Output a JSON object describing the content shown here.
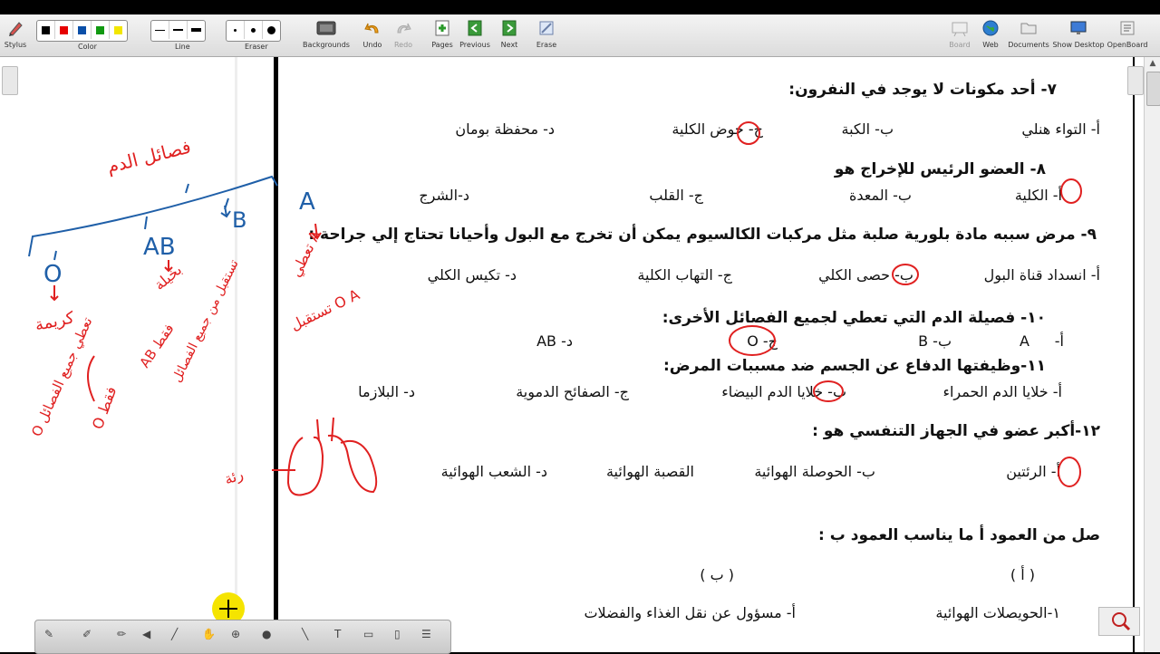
{
  "toolbar": {
    "stylus_label": "Stylus",
    "color_label": "Color",
    "line_label": "Line",
    "eraser_label": "Eraser",
    "backgrounds_label": "Backgrounds",
    "undo_label": "Undo",
    "redo_label": "Redo",
    "pages_label": "Pages",
    "previous_label": "Previous",
    "next_label": "Next",
    "erase_label": "Erase",
    "board_label": "Board",
    "web_label": "Web",
    "documents_label": "Documents",
    "show_desktop_label": "Show Desktop",
    "openboard_label": "OpenBoard",
    "colors": [
      "#000000",
      "#e60000",
      "#0a4fa8",
      "#119911",
      "#f2e600"
    ]
  },
  "questions": {
    "q7": {
      "text": "٧- أحد مكونات لا يوجد في النفرون:",
      "a": "أ- التواء هنلي",
      "b": "ب- الكبة",
      "c": "ج- حوض الكلية",
      "d": "د- محفظة بومان"
    },
    "q8": {
      "text": "٨- العضو الرئيس للإخراج هو",
      "a": "أ- الكلية",
      "b": "ب- المعدة",
      "c": "ج- القلب",
      "d": "د-الشرج"
    },
    "q9": {
      "text": "٩- مرض سببه مادة بلورية صلبة مثل مركبات الكالسيوم يمكن أن تخرج مع البول وأحيانا تحتاج إلي جراحة :",
      "a": "أ- انسداد قناة البول",
      "b": "ب- حصى الكلي",
      "c": "ج- التهاب الكلية",
      "d": "د- تكيس الكلي"
    },
    "q10": {
      "text": "١٠- فصيلة الدم التي تعطي لجميع الفصائل الأخرى:",
      "a_prefix": "أ-",
      "a": "A",
      "b": "ب- B",
      "c": "ج- O",
      "d": "د- AB"
    },
    "q11": {
      "text": "١١-وظيفتها الدفاع عن الجسم ضد مسببات المرض:",
      "a": "أ- خلايا الدم الحمراء",
      "b": "ب- خلايا الدم البيضاء",
      "c": "ج- الصفائح الدموية",
      "d": "د- البلازما"
    },
    "q12": {
      "text": "١٢-أكبر عضو في الجهاز التنفسي هو :",
      "a": "أ- الرئتين",
      "b": "ب- الحوصلة الهوائية",
      "c": "القصبة الهوائية",
      "d": "د- الشعب الهوائية"
    }
  },
  "matching": {
    "title": "صل من العمود أ ما يناسب العمود ب :",
    "col_a_header": "( أ )",
    "col_b_header": "( ب )",
    "row1_a": "١-الحويصلات الهوائية",
    "row1_b": "أ- مسؤول عن نقل الغذاء والفضلات"
  },
  "annotations": {
    "blood_types_title": "فصائل الدم",
    "type_a": "A",
    "type_b": "B",
    "type_ab": "AB",
    "type_o": "O",
    "o_note": "كريمة",
    "ab_note": "بخيلة",
    "a_gives": "تعطي A",
    "a_receives": "تستقبل O A",
    "ab_receives": "AB فقط",
    "ab_receives_all": "تستقبل من جميع الفصائل",
    "o_gives": "O تعطي جميع الفصائل",
    "o_only": "O فقط",
    "lung_label": "رئة"
  }
}
